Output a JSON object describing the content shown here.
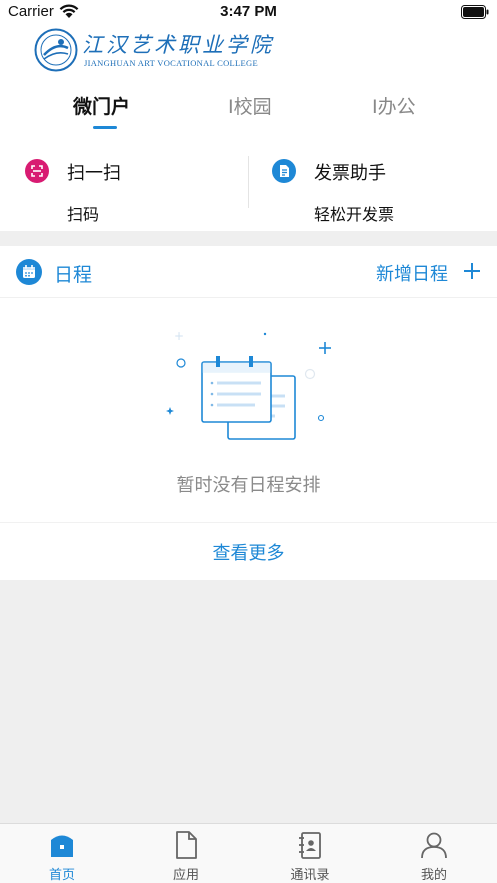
{
  "status_bar": {
    "carrier": "Carrier",
    "time": "3:47 PM"
  },
  "header": {
    "logo_cn": "江汉艺术职业学院",
    "logo_en": "JIANGHUAN ART VOCATIONAL COLLEGE"
  },
  "tabs": [
    {
      "label": "微门户",
      "active": true
    },
    {
      "label": "I校园",
      "active": false
    },
    {
      "label": "I办公",
      "active": false
    }
  ],
  "quick_actions": [
    {
      "title": "扫一扫",
      "subtitle": "扫码",
      "icon": "scan-icon",
      "color": "#d81b72"
    },
    {
      "title": "发票助手",
      "subtitle": "轻松开发票",
      "icon": "invoice-icon",
      "color": "#1e88d6"
    }
  ],
  "schedule": {
    "title": "日程",
    "add_label": "新增日程",
    "empty_text": "暂时没有日程安排",
    "more_label": "查看更多"
  },
  "bottom_nav": [
    {
      "label": "首页",
      "icon": "home-icon",
      "active": true
    },
    {
      "label": "应用",
      "icon": "document-icon",
      "active": false
    },
    {
      "label": "通讯录",
      "icon": "contacts-icon",
      "active": false
    },
    {
      "label": "我的",
      "icon": "user-icon",
      "active": false
    }
  ],
  "colors": {
    "accent": "#1e88d6",
    "scan": "#d81b72",
    "background": "#efefef"
  }
}
